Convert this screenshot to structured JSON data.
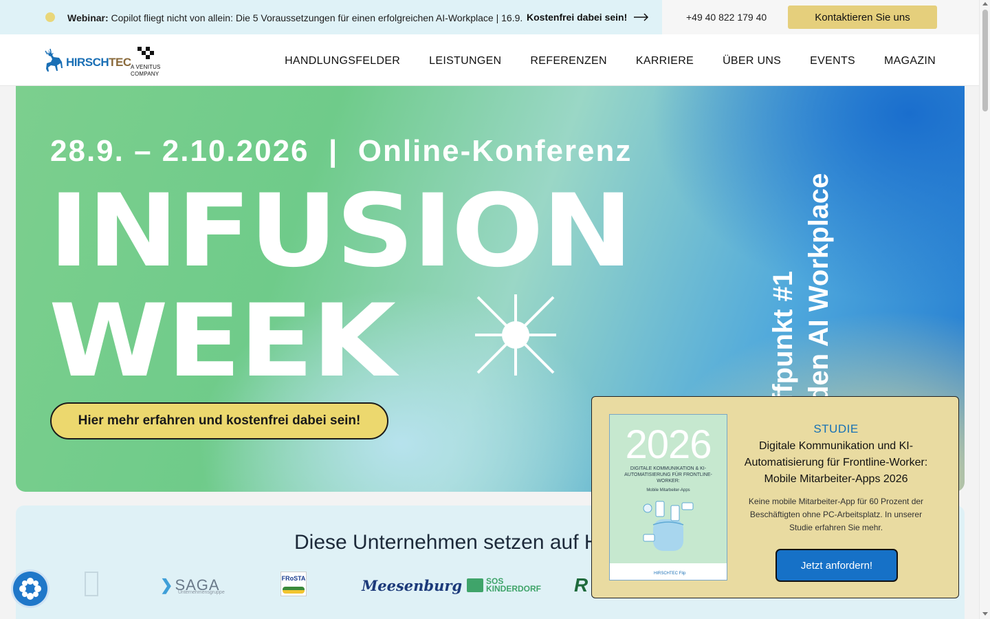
{
  "topbar": {
    "webinar_label": "Webinar:",
    "webinar_text": "Copilot fliegt nicht von allein: Die 5 Voraussetzungen für einen erfolgreichen AI-Workplace | 16.9.",
    "cta_label": "Kostenfrei dabei sein!",
    "phone": "+49 40 822 179 40",
    "contact_button": "Kontaktieren Sie uns"
  },
  "nav": {
    "logo_hirsch": "HIRSCH",
    "logo_tec": "TEC",
    "venitus_line1": "A VENITUS",
    "venitus_line2": "COMPANY",
    "menu": [
      "HANDLUNGSFELDER",
      "LEISTUNGEN",
      "REFERENZEN",
      "KARRIERE",
      "ÜBER UNS",
      "EVENTS",
      "MAGAZIN"
    ]
  },
  "hero": {
    "date_line": "28.9. – 2.10.2026  |  Online-Konferenz",
    "title_line1": "INFUSION",
    "title_line2": "WEEK",
    "vertical_line1": "ffpunkt #1",
    "vertical_line2": "den AI Workplace",
    "cta_button": "Hier mehr erfahren und kostenfrei dabei sein!"
  },
  "customers": {
    "title": "Diese Unternehmen setzen auf H",
    "logos": {
      "saga": "SAGA",
      "saga_sub": "Unternehmensgruppe",
      "frosta": "FRoSTA",
      "meesenburg": "Meesenburg",
      "sos_line1": "SOS",
      "sos_line2": "KINDERDORF",
      "r_logo": "R"
    }
  },
  "popup": {
    "kicker": "STUDIE",
    "title": "Digitale Kommunikation und KI-Automatisierung für Frontline-Worker: Mobile Mitarbeiter-Apps 2026",
    "body": "Keine mobile Mitarbeiter-App für 60 Prozent der Beschäftigten ohne PC-Arbeitsplatz. In unserer Studie erfahren Sie mehr.",
    "button": "Jetzt anfordern!",
    "cover": {
      "year": "2026",
      "title": "DIGITALE KOMMUNIKATION & KI-AUTOMATISIERUNG FÜR FRONTLINE-WORKER:",
      "subtitle": "Mobile Mitarbeiter-Apps",
      "footer_logos": "HIRSCHTEC  Flip"
    }
  },
  "colors": {
    "accent_yellow": "#e5cf7c",
    "brand_blue": "#1671c7",
    "hero_green": "#7ccf8e"
  },
  "icons": {
    "arrow": "arrow-right-icon",
    "star": "sparkle-star-icon",
    "widget": "accessibility-widget-icon",
    "deer": "deer-logo-icon"
  }
}
